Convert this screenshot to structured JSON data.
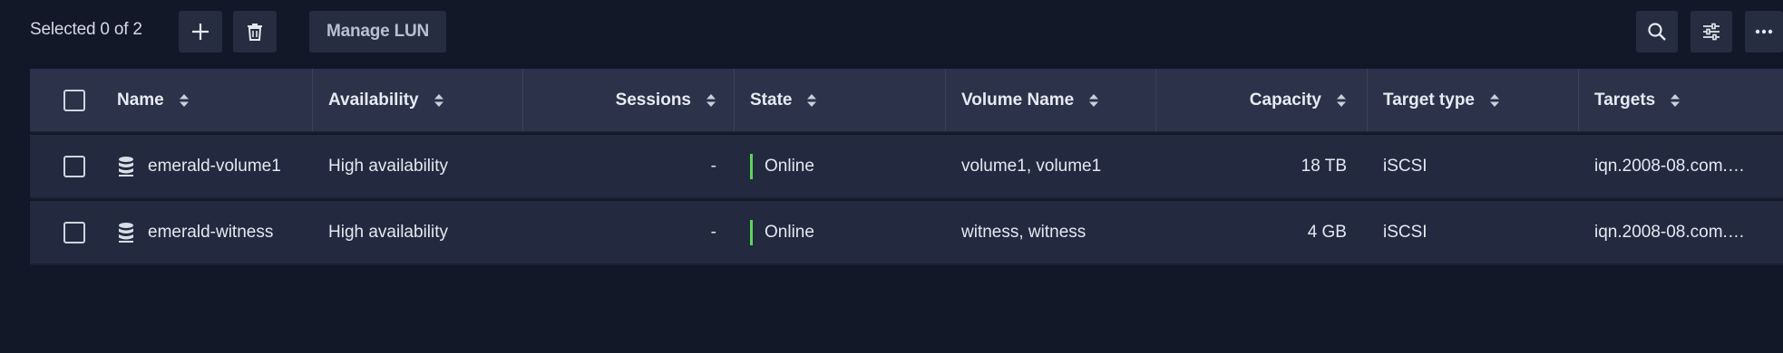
{
  "toolbar": {
    "selection_text": "Selected 0 of 2",
    "manage_lun_label": "Manage LUN",
    "add_icon": "plus-icon",
    "delete_icon": "trash-icon",
    "search_icon": "search-icon",
    "filter_icon": "filter-settings-icon",
    "more_icon": "more-options-icon"
  },
  "table": {
    "columns": [
      {
        "label": "Name"
      },
      {
        "label": "Availability"
      },
      {
        "label": "Sessions"
      },
      {
        "label": "State"
      },
      {
        "label": "Volume Name"
      },
      {
        "label": "Capacity"
      },
      {
        "label": "Target type"
      },
      {
        "label": "Targets"
      }
    ],
    "rows": [
      {
        "name": "emerald-volume1",
        "availability": "High availability",
        "sessions": "-",
        "state": "Online",
        "volume_name": "volume1, volume1",
        "capacity": "18 TB",
        "target_type": "iSCSI",
        "targets": "iqn.2008-08.com.…"
      },
      {
        "name": "emerald-witness",
        "availability": "High availability",
        "sessions": "-",
        "state": "Online",
        "volume_name": "witness, witness",
        "capacity": "4 GB",
        "target_type": "iSCSI",
        "targets": "iqn.2008-08.com.…"
      }
    ]
  },
  "colors": {
    "background": "#131828",
    "row_bg": "#232a3f",
    "header_bg": "#2b3249",
    "online_indicator": "#5fd35b"
  }
}
